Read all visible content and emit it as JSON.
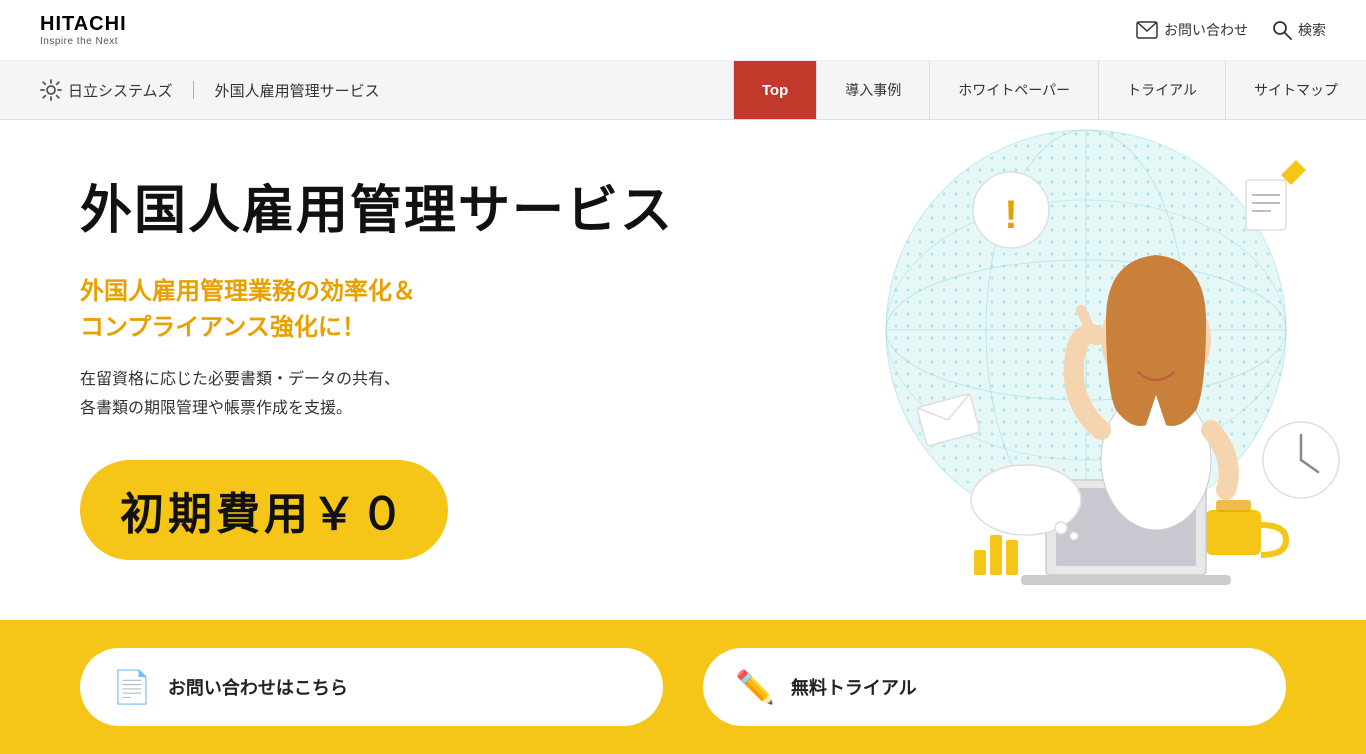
{
  "topHeader": {
    "logo": {
      "brand": "HITACHI",
      "tagline": "Inspire the Next"
    },
    "contact": "お問い合わせ",
    "search": "検索"
  },
  "navBar": {
    "brandLogo": "日立システムズ",
    "separator": "｜",
    "brandName": "外国人雇用管理サービス",
    "links": [
      {
        "label": "Top",
        "active": true
      },
      {
        "label": "導入事例",
        "active": false
      },
      {
        "label": "ホワイトペーパー",
        "active": false
      },
      {
        "label": "トライアル",
        "active": false
      },
      {
        "label": "サイトマップ",
        "active": false
      }
    ]
  },
  "hero": {
    "title": "外国人雇用管理サービス",
    "subtitle_line1": "外国人雇用管理業務の効率化＆",
    "subtitle_line2": "コンプライアンス強化に！",
    "desc_line1": "在留資格に応じた必要書類・データの共有、",
    "desc_line2": "各書類の期限管理や帳票作成を支援。",
    "badge": "初期費用￥０"
  },
  "cta": {
    "card1": {
      "icon": "📄",
      "text": "お問い合わせはこちら"
    },
    "card2": {
      "icon": "✏️",
      "text": "無料トライアル"
    }
  },
  "colors": {
    "accent_red": "#c0392b",
    "accent_yellow": "#f5c518",
    "accent_orange": "#e8a000",
    "teal": "#7dd0d0"
  }
}
